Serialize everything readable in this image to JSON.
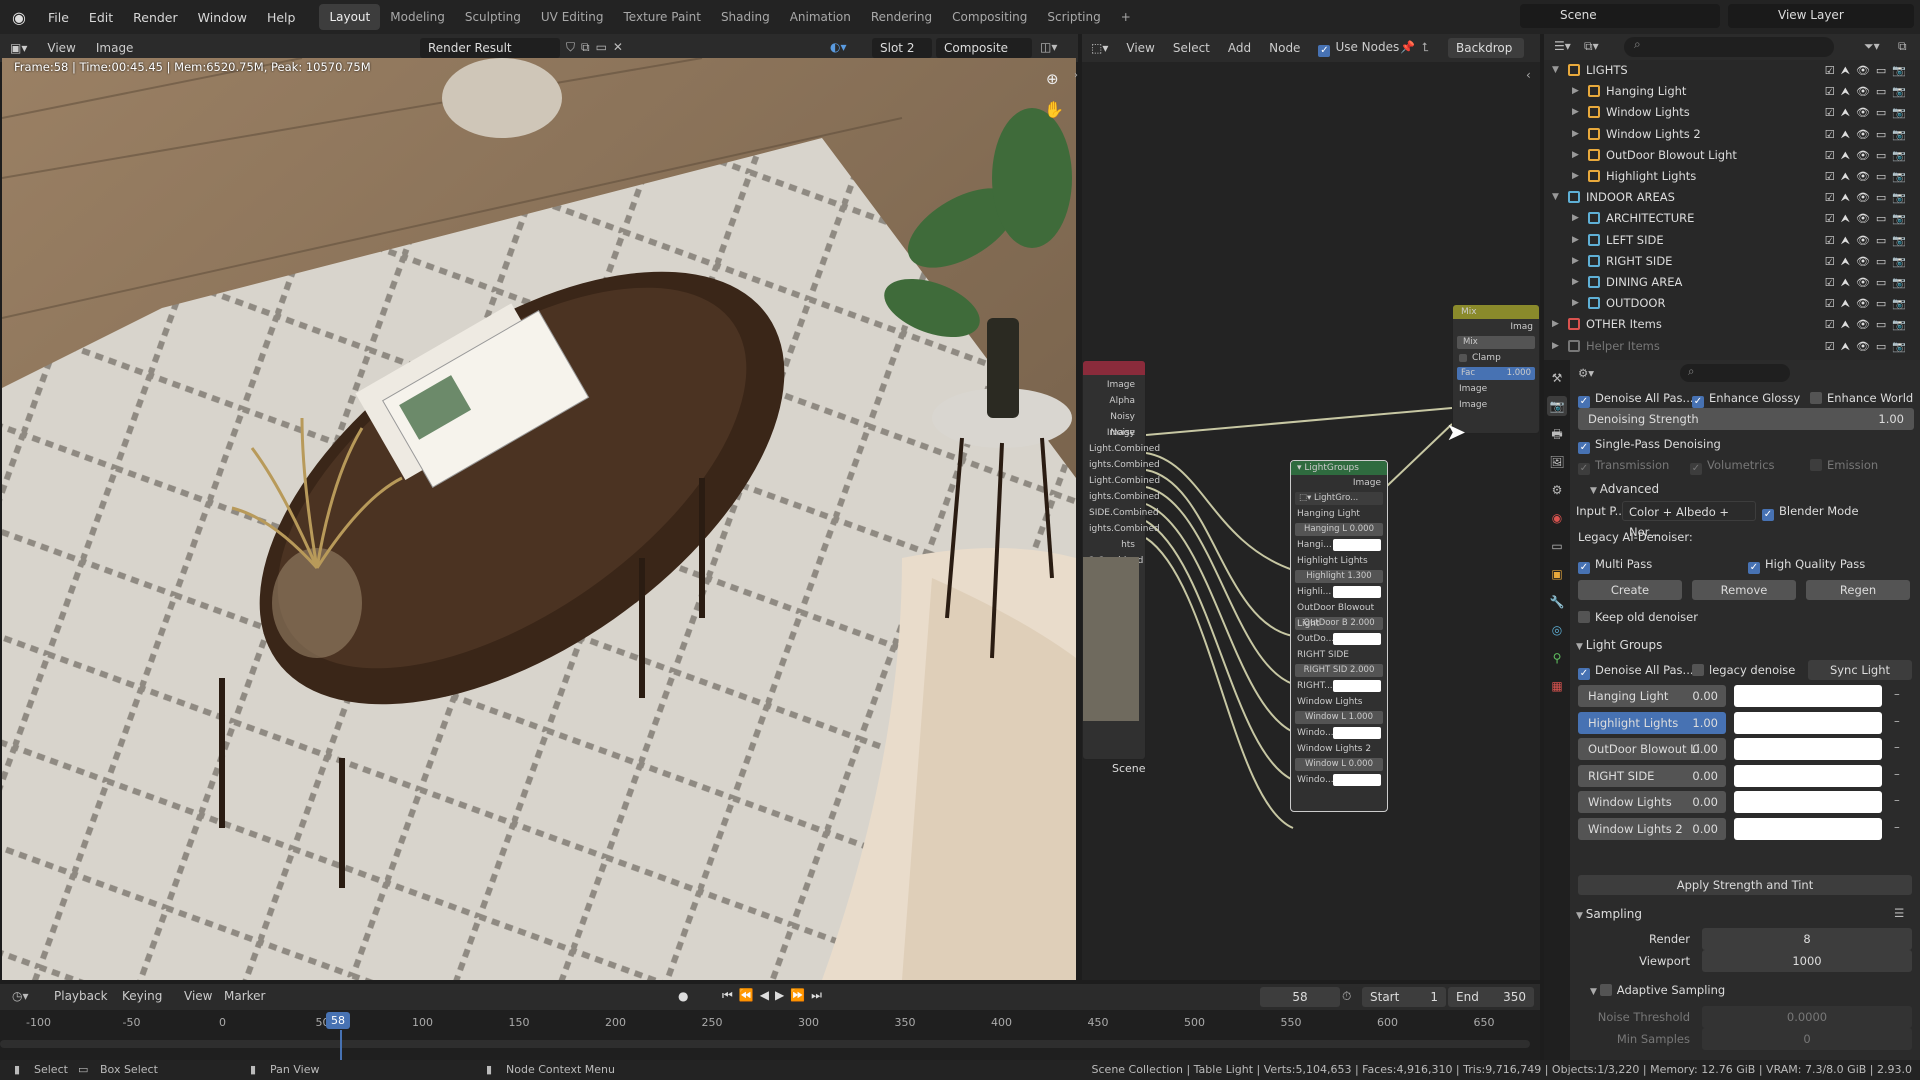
{
  "topbar": {
    "menu": [
      "File",
      "Edit",
      "Render",
      "Window",
      "Help"
    ],
    "workspaces": [
      "Layout",
      "Modeling",
      "Sculpting",
      "UV Editing",
      "Texture Paint",
      "Shading",
      "Animation",
      "Rendering",
      "Compositing",
      "Scripting",
      "+"
    ],
    "active_workspace": "Layout",
    "scene": "Scene",
    "view_layer": "View Layer"
  },
  "image_editor": {
    "menu": [
      "View",
      "Image"
    ],
    "image_name": "Render Result",
    "slot": "Slot 2",
    "pass": "Composite",
    "render_info": "Frame:58 | Time:00:45.45 | Mem:6520.75M, Peak: 10570.75M"
  },
  "node_editor": {
    "menu": [
      "View",
      "Select",
      "Add",
      "Node"
    ],
    "use_nodes_label": "Use Nodes",
    "backdrop_label": "Backdrop",
    "scene_label": "Scene",
    "rlayer_outputs": [
      "Image",
      "Alpha",
      "Noisy Image",
      "Noisy",
      "Light.Combined",
      "ights.Combined",
      "Light.Combined",
      "ights.Combined",
      "SIDE.Combined",
      "ights.Combined",
      "hts 2.Combined"
    ],
    "mix_node": {
      "title": "Mix",
      "out": "Imag",
      "blend": "Mix",
      "clamp": "Clamp",
      "fac_label": "Fac",
      "fac": "1.000",
      "in1": "Image",
      "in2": "Image"
    },
    "lightgroups_node": {
      "title": "LightGroups",
      "output": "Image",
      "group": "LightGro...",
      "rows": [
        {
          "name": "Hanging Light",
          "field": "Hanging L 0.000",
          "short": "Hangi..."
        },
        {
          "name": "Highlight Lights",
          "field": "Highlight 1.300",
          "short": "Highli..."
        },
        {
          "name": "OutDoor Blowout Light",
          "field": "OutDoor B 2.000",
          "short": "OutDo..."
        },
        {
          "name": "RIGHT SIDE",
          "field": "RIGHT SID 2.000",
          "short": "RIGHT..."
        },
        {
          "name": "Window Lights",
          "field": "Window L 1.000",
          "short": "Windo..."
        },
        {
          "name": "Window Lights 2",
          "field": "Window L 0.000",
          "short": "Windo..."
        }
      ]
    }
  },
  "outliner": {
    "rows": [
      {
        "name": "LIGHTS",
        "level": 0,
        "color": "#e8a93c",
        "expanded": true
      },
      {
        "name": "Hanging Light",
        "level": 1,
        "color": "#e8a93c"
      },
      {
        "name": "Window Lights",
        "level": 1,
        "color": "#e8a93c"
      },
      {
        "name": "Window Lights 2",
        "level": 1,
        "color": "#e8a93c"
      },
      {
        "name": "OutDoor Blowout Light",
        "level": 1,
        "color": "#e8a93c"
      },
      {
        "name": "Highlight Lights",
        "level": 1,
        "color": "#e8a93c"
      },
      {
        "name": "INDOOR AREAS",
        "level": 0,
        "color": "#5fb0d6",
        "expanded": true
      },
      {
        "name": "ARCHITECTURE",
        "level": 1,
        "color": "#5fb0d6"
      },
      {
        "name": "LEFT SIDE",
        "level": 1,
        "color": "#5fb0d6"
      },
      {
        "name": "RIGHT SIDE",
        "level": 1,
        "color": "#5fb0d6"
      },
      {
        "name": "DINING AREA",
        "level": 1,
        "color": "#5fb0d6"
      },
      {
        "name": "OUTDOOR",
        "level": 1,
        "color": "#5fb0d6"
      },
      {
        "name": "OTHER Items",
        "level": 0,
        "color": "#d9534f"
      },
      {
        "name": "Helper Items",
        "level": 0,
        "color": "#777777",
        "dim": true
      }
    ]
  },
  "properties": {
    "denoise_all_passes": "Denoise All Pas...",
    "enhance_glossy": "Enhance Glossy",
    "enhance_world": "Enhance World ...",
    "denoising_strength_label": "Denoising Strength",
    "denoising_strength": "1.00",
    "single_pass": "Single-Pass Denoising",
    "transmission": "Transmission",
    "volumetrics": "Volumetrics",
    "emission": "Emission",
    "advanced": "Advanced",
    "input_label": "Input P...",
    "input_value": "Color + Albedo + Nor...",
    "blender_mode": "Blender Mode",
    "legacy_label": "Legacy AI-Denoiser:",
    "multi_pass": "Multi Pass",
    "high_quality": "High Quality Pass",
    "create": "Create",
    "remove": "Remove",
    "regen": "Regen",
    "keep_old": "Keep old denoiser",
    "light_groups_header": "Light Groups",
    "lg_denoise_all": "Denoise All Pas...",
    "legacy_denoise": "legacy denoise",
    "sync_light_groups": "Sync Light Groups",
    "light_groups": [
      {
        "name": "Hanging Light",
        "value": "0.00",
        "selected": false
      },
      {
        "name": "Highlight Lights",
        "value": "1.00",
        "selected": true
      },
      {
        "name": "OutDoor Blowout Li",
        "value": "0.00",
        "selected": false
      },
      {
        "name": "RIGHT SIDE",
        "value": "0.00",
        "selected": false
      },
      {
        "name": "Window Lights",
        "value": "0.00",
        "selected": false
      },
      {
        "name": "Window Lights 2",
        "value": "0.00",
        "selected": false
      }
    ],
    "apply_strength": "Apply Strength and Tint",
    "sampling_header": "Sampling",
    "render_label": "Render",
    "render_value": "8",
    "viewport_label": "Viewport",
    "viewport_value": "1000",
    "adaptive_sampling": "Adaptive Sampling",
    "noise_threshold_label": "Noise Threshold",
    "noise_threshold": "0.0000",
    "min_samples_label": "Min Samples",
    "min_samples": "0"
  },
  "timeline": {
    "menu": [
      "Playback",
      "Keying",
      "View",
      "Marker"
    ],
    "current_frame": "58",
    "start_label": "Start",
    "start": "1",
    "end_label": "End",
    "end": "350",
    "ruler": [
      "-100",
      "-50",
      "0",
      "50",
      "100",
      "150",
      "200",
      "250",
      "300",
      "350",
      "400",
      "450",
      "500",
      "550",
      "600",
      "650"
    ]
  },
  "statusbar": {
    "select": "Select",
    "box_select": "Box Select",
    "pan_view": "Pan View",
    "node_context": "Node Context Menu",
    "stats": "Scene Collection | Table Light | Verts:5,104,653 | Faces:4,916,310 | Tris:9,716,749 | Objects:1/3,220 | Memory: 12.76 GiB | VRAM: 7.3/8.0 GiB | 2.93.0"
  }
}
